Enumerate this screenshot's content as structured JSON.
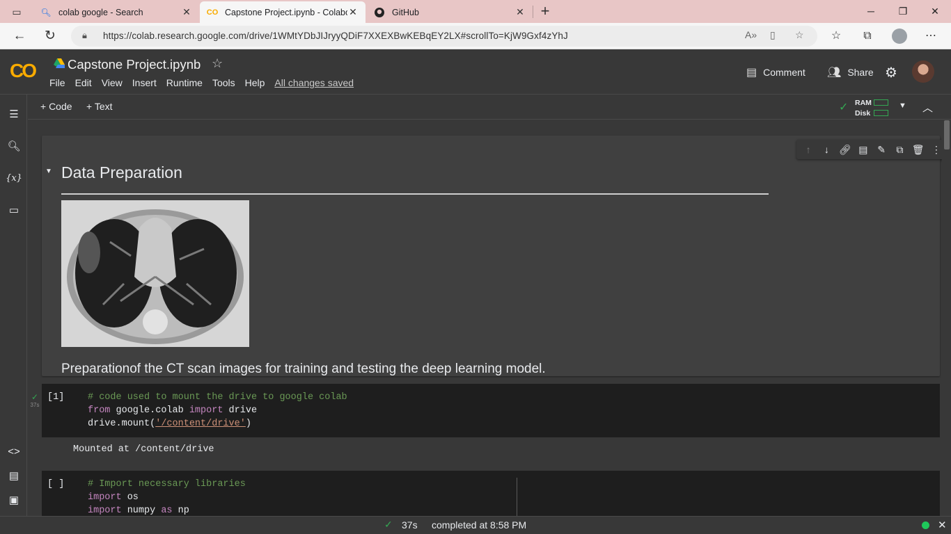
{
  "browser": {
    "tabs": [
      {
        "title": "colab google - Search",
        "icon": "search-icon"
      },
      {
        "title": "Capstone Project.ipynb - Colabor",
        "icon": "colab-icon"
      },
      {
        "title": "GitHub",
        "icon": "github-icon"
      }
    ],
    "url": "https://colab.research.google.com/drive/1WMtYDbJIJryyQDiF7XXEXBwKEBqEY2LX#scrollTo=KjW9Gxf4zYhJ"
  },
  "colab": {
    "logo": "CO",
    "notebook_title": "Capstone Project.ipynb",
    "menu": [
      "File",
      "Edit",
      "View",
      "Insert",
      "Runtime",
      "Tools",
      "Help"
    ],
    "save_status": "All changes saved",
    "comment_label": "Comment",
    "share_label": "Share"
  },
  "toolbar": {
    "add_code": "+ Code",
    "add_text": "+ Text",
    "ram_label": "RAM",
    "disk_label": "Disk"
  },
  "cells": {
    "markdown": {
      "heading": "Data Preparation",
      "text": "Preparationof the CT scan images for training and testing the deep learning model."
    },
    "code1": {
      "exec_count": "[1]",
      "duration": "37s",
      "comment": "# code used to mount the drive to google colab",
      "kw_from": "from",
      "module": " google.colab ",
      "kw_import": "import",
      "name": " drive",
      "call_prefix": "drive.mount(",
      "path": "'/content/drive'",
      "call_suffix": ")",
      "output": "Mounted at /content/drive"
    },
    "code2": {
      "exec_count": "[ ]",
      "comment": "# Import necessary libraries",
      "kw_import": "import",
      "lib_os": " os",
      "lib_numpy": " numpy ",
      "kw_as": "as",
      "alias": " np"
    }
  },
  "status": {
    "duration": "37s",
    "completed": "completed at 8:58 PM"
  },
  "colors": {
    "accent_orange": "#f9ab00",
    "success_green": "#34a853",
    "comment_green": "#6a9955",
    "keyword_purple": "#c586c0",
    "string_orange": "#ce9178"
  }
}
